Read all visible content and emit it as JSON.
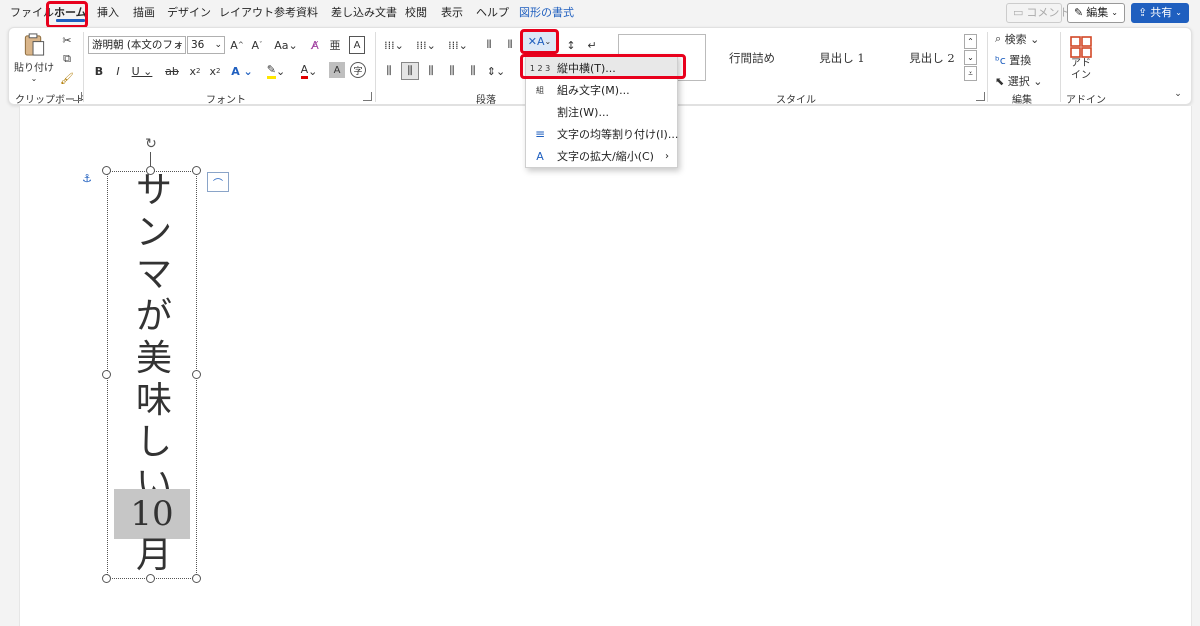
{
  "menubar": {
    "tabs": [
      "ファイル",
      "ホーム",
      "挿入",
      "描画",
      "デザイン",
      "レイアウト",
      "参考資料",
      "差し込み文書",
      "校閲",
      "表示",
      "ヘルプ",
      "図形の書式"
    ],
    "comment_label": "コメント",
    "edit_label": "編集",
    "share_label": "共有"
  },
  "ribbon": {
    "clipboard": {
      "label": "クリップボード",
      "paste": "貼り付け"
    },
    "font": {
      "label": "フォント",
      "font_name": "游明朝 (本文のフォン",
      "font_size": "36"
    },
    "paragraph": {
      "label": "段落"
    },
    "styles": {
      "label": "スタイル",
      "items": [
        "",
        "行間詰め",
        "見出し 1",
        "見出し 2"
      ]
    },
    "editing": {
      "label": "編集",
      "find": "検索",
      "replace": "置換",
      "select": "選択"
    },
    "addin": {
      "label": "アドイン",
      "button": "アド\nイン"
    }
  },
  "dropdown": {
    "items": [
      {
        "icon": "1 2 3",
        "label": "縦中横(T)..."
      },
      {
        "icon": "組",
        "label": "組み文字(M)..."
      },
      {
        "icon": "",
        "label": "割注(W)..."
      },
      {
        "icon": "≡",
        "label": "文字の均等割り付け(I)..."
      },
      {
        "icon": "A",
        "label": "文字の拡大/縮小(C)",
        "submenu": "›"
      }
    ]
  },
  "document": {
    "vertical_text": [
      "サ",
      "ン",
      "マ",
      "が",
      "美",
      "味",
      "し",
      "い"
    ],
    "tcy_text": "10",
    "last_char": "月"
  },
  "colors": {
    "accent": "#1f5fbf",
    "highlight_box": "#e8001c"
  }
}
